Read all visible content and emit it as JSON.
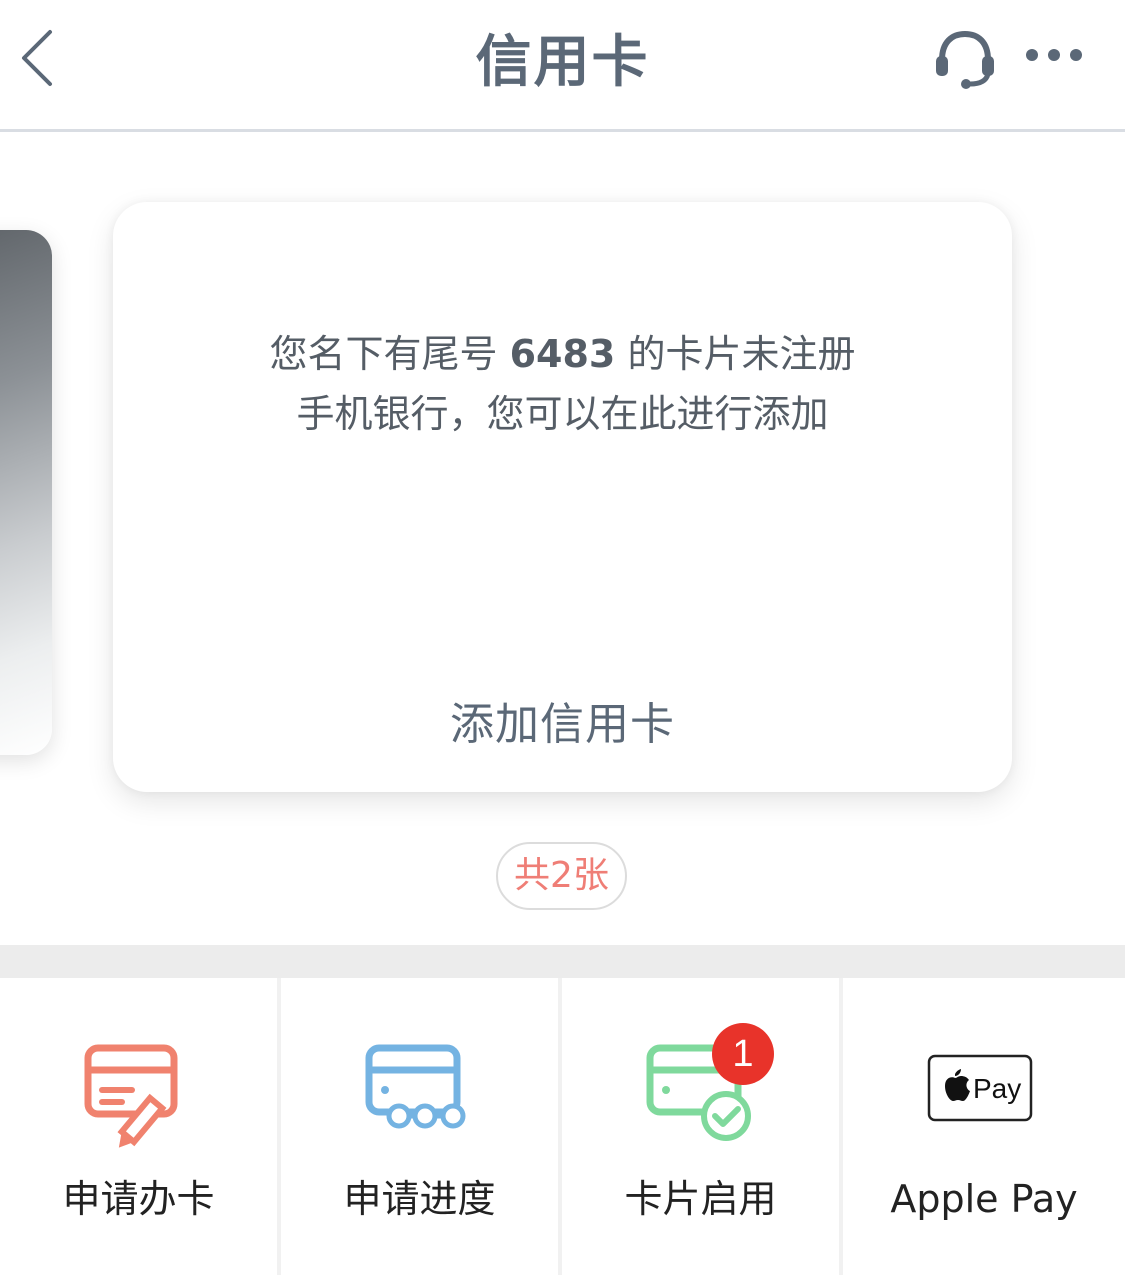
{
  "nav": {
    "title": "信用卡",
    "back_icon": "chevron-left-icon",
    "service_icon": "headset-icon",
    "more_icon": "more-dots-icon"
  },
  "card": {
    "message_line1_pre": "您名下有尾号 ",
    "card_tail": "6483",
    "message_line1_post": " 的卡片未注册",
    "message_line2": "手机银行，您可以在此进行添加",
    "add_label": "添加信用卡"
  },
  "carousel": {
    "count_label": "共2张"
  },
  "actions": [
    {
      "label": "申请办卡",
      "icon": "card-apply-icon",
      "color": "#f0826e"
    },
    {
      "label": "申请进度",
      "icon": "card-progress-icon",
      "color": "#74b3e2"
    },
    {
      "label": "卡片启用",
      "icon": "card-activate-icon",
      "color": "#7fd99c",
      "badge": "1"
    },
    {
      "label": "Apple Pay",
      "icon": "apple-pay-icon",
      "color": "#222222",
      "logo_text": "Pay"
    }
  ],
  "colors": {
    "title": "#5b6877",
    "accent_red": "#e8332a",
    "count_text": "#ef7e76"
  }
}
